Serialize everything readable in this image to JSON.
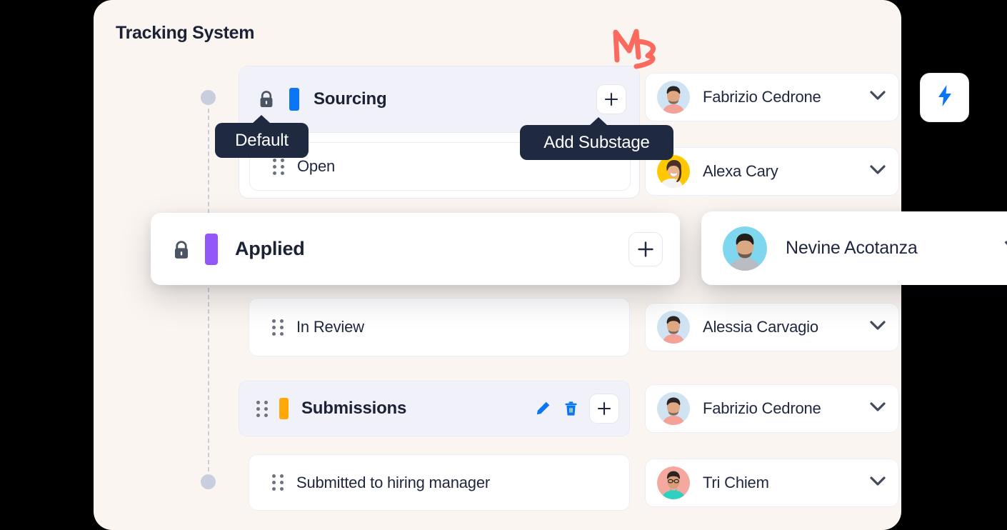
{
  "panel": {
    "title": "Tracking System",
    "background_color": "#faf5f0"
  },
  "decorations": {
    "red_cursor_mark": "hand-drawn-click-mark",
    "red_color": "#fa6a5f"
  },
  "timeline": {
    "line_style": "dashed",
    "line_color": "#c9cede",
    "dot_color": "#c9cede",
    "dot_count": 2
  },
  "tooltips": [
    {
      "id": "default",
      "label": "Default"
    },
    {
      "id": "add-substage",
      "label": "Add Substage"
    }
  ],
  "stages": [
    {
      "id": "sourcing",
      "name": "Sourcing",
      "locked": true,
      "color": "#0a76f6",
      "selected": true,
      "add_label": "+",
      "substages": [
        {
          "id": "open",
          "name": "Open"
        }
      ]
    },
    {
      "id": "applied",
      "name": "Applied",
      "locked": true,
      "color": "#9457f7",
      "elevated": true,
      "add_label": "+",
      "substages": [
        {
          "id": "in-review",
          "name": "In Review"
        },
        {
          "id": "submissions",
          "name": "Submissions",
          "color": "#ffa806",
          "highlighted": true,
          "has_edit": true,
          "has_delete": true,
          "add_label": "+"
        },
        {
          "id": "submitted",
          "name": "Submitted to hiring manager"
        }
      ]
    }
  ],
  "people": [
    {
      "id": "p1",
      "name": "Fabrizio Cedrone",
      "avatar": "man-beard-pink-shirt",
      "avatar_bg": "#cfe3f2",
      "skin": "#e0a882",
      "hair": "#2a2424",
      "shirt": "#f4a197"
    },
    {
      "id": "p2",
      "name": "Alexa Cary",
      "avatar": "woman-laughing-yellow-bg",
      "avatar_bg": "#ffc800",
      "skin": "#e8b48f",
      "hair": "#4a3027",
      "shirt": "#f2f2f2"
    },
    {
      "id": "p3",
      "name": "Nevine Acotanza",
      "avatar": "man-beard-grey-sweater",
      "avatar_bg": "#7fd7ef",
      "skin": "#dba884",
      "hair": "#221e1c",
      "shirt": "#b9bcc2"
    },
    {
      "id": "p4",
      "name": "Alessia Carvagio",
      "avatar": "man-beard-pink-shirt",
      "avatar_bg": "#cfe3f2",
      "skin": "#e0a882",
      "hair": "#2a2424",
      "shirt": "#f4a197"
    },
    {
      "id": "p5",
      "name": "Fabrizio Cedrone",
      "avatar": "man-beard-pink-shirt",
      "avatar_bg": "#cfe3f2",
      "skin": "#e0a882",
      "hair": "#2a2424",
      "shirt": "#f4a197"
    },
    {
      "id": "p6",
      "name": "Tri Chiem",
      "avatar": "man-glasses-teal-shirt",
      "avatar_bg": "#f4a89f",
      "skin": "#d99d79",
      "hair": "#2b2320",
      "shirt": "#2fd0c0"
    }
  ],
  "actions": {
    "bolt_button": "lightning-bolt",
    "bolt_color": "#0a76f6",
    "edit_color": "#0a76f6",
    "delete_color": "#0a76f6"
  }
}
